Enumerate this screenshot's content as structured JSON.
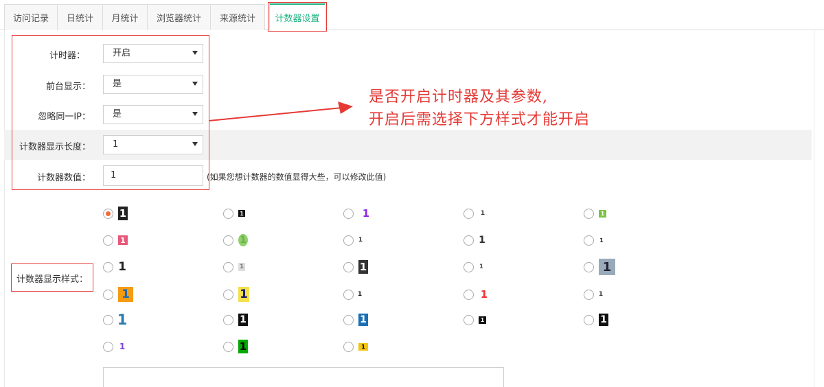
{
  "tabs": [
    {
      "label": "访问记录"
    },
    {
      "label": "日统计"
    },
    {
      "label": "月统计"
    },
    {
      "label": "浏览器统计"
    },
    {
      "label": "来源统计"
    },
    {
      "label": "计数器设置",
      "active": true
    }
  ],
  "form": {
    "timer": {
      "label": "计时器：",
      "value": "开启"
    },
    "frontend": {
      "label": "前台显示：",
      "value": "是"
    },
    "ignore_ip": {
      "label": "忽略同一IP：",
      "value": "是"
    },
    "display_length": {
      "label": "计数器显示长度：",
      "value": "1"
    },
    "counter_value": {
      "label": "计数器数值：",
      "value": "1"
    },
    "counter_hint": "(如果您想计数器的数值显得大些，可以修改此值)",
    "style_label": "计数器显示样式："
  },
  "annotation": {
    "line1": "是否开启计时器及其参数,",
    "line2": "开启后需选择下方样式才能开启"
  },
  "styles": {
    "selected_index": 0,
    "digit": "1",
    "colors": {
      "accent": "#21b384",
      "annotation": "#e53935",
      "radio_on": "#f26b3a"
    }
  }
}
